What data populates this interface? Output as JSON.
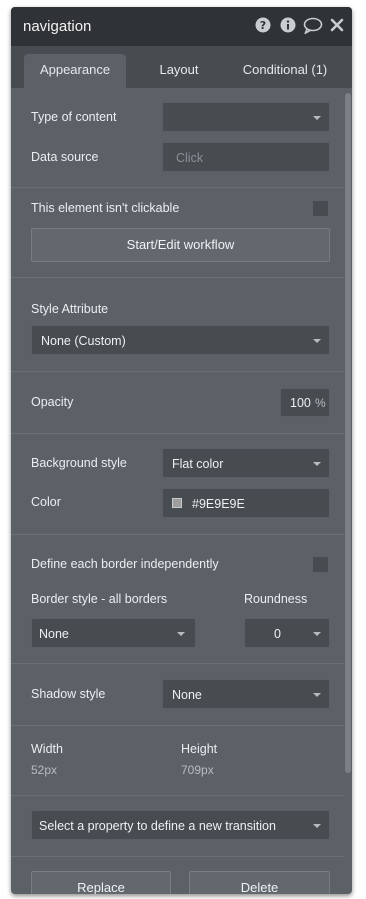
{
  "header": {
    "title": "navigation"
  },
  "tabs": [
    {
      "label": "Appearance",
      "active": true
    },
    {
      "label": "Layout",
      "active": false
    },
    {
      "label": "Conditional (1)",
      "active": false
    }
  ],
  "content": {
    "type_of_content_label": "Type of content",
    "type_of_content_value": "",
    "data_source_label": "Data source",
    "data_source_placeholder": "Click"
  },
  "clickable": {
    "label": "This element isn't clickable",
    "checked": false,
    "workflow_button": "Start/Edit workflow"
  },
  "style": {
    "label": "Style Attribute",
    "value": "None (Custom)"
  },
  "opacity": {
    "label": "Opacity",
    "value": "100",
    "unit": "%"
  },
  "background": {
    "style_label": "Background style",
    "style_value": "Flat color",
    "color_label": "Color",
    "color_value": "#9E9E9E",
    "swatch_color": "#9e9e9e"
  },
  "border": {
    "independent_label": "Define each border independently",
    "independent_checked": false,
    "style_label": "Border style - all borders",
    "style_value": "None",
    "roundness_label": "Roundness",
    "roundness_value": "0"
  },
  "shadow": {
    "label": "Shadow style",
    "value": "None"
  },
  "dimensions": {
    "width_label": "Width",
    "width_value": "52px",
    "height_label": "Height",
    "height_value": "709px"
  },
  "transition": {
    "placeholder": "Select a property to define a new transition"
  },
  "footer": {
    "replace_label": "Replace",
    "delete_label": "Delete"
  },
  "icons": [
    "help-icon",
    "info-icon",
    "comment-icon",
    "close-icon",
    "chevron-down-icon"
  ]
}
